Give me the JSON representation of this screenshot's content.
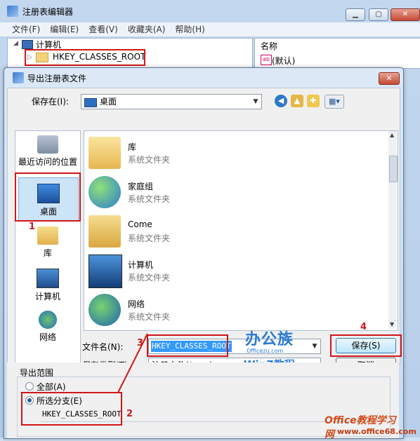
{
  "registry": {
    "title": "注册表编辑器",
    "menu": [
      "文件(F)",
      "编辑(E)",
      "查看(V)",
      "收藏夹(A)",
      "帮助(H)"
    ],
    "tree_root": "计算机",
    "tree_item": "HKEY_CLASSES_ROOT",
    "col_name": "名称",
    "default_value": "(默认)",
    "default_value_icon_text": "ab"
  },
  "dialog": {
    "title": "导出注册表文件",
    "close_label": "✕",
    "save_in_label": "保存在(I):",
    "save_in_value": "桌面",
    "places": [
      {
        "label": "最近访问的位置",
        "icon": "recent-places-icon"
      },
      {
        "label": "桌面",
        "icon": "desktop-icon"
      },
      {
        "label": "库",
        "icon": "libraries-icon"
      },
      {
        "label": "计算机",
        "icon": "computer-icon"
      },
      {
        "label": "网络",
        "icon": "network-icon"
      }
    ],
    "files": [
      {
        "name": "库",
        "type": "系统文件夹",
        "icon": "library-folder-icon"
      },
      {
        "name": "家庭组",
        "type": "系统文件夹",
        "icon": "homegroup-icon"
      },
      {
        "name": "Come",
        "type": "系统文件夹",
        "icon": "user-folder-icon"
      },
      {
        "name": "计算机",
        "type": "系统文件夹",
        "icon": "computer-icon"
      },
      {
        "name": "网络",
        "type": "系统文件夹",
        "icon": "network-icon"
      }
    ],
    "filename_label": "文件名(N):",
    "filename_value": "HKEY_CLASSES_ROOT",
    "filetype_label": "保存类型(T):",
    "filetype_value": "注册文件(*.reg)",
    "save_button": "保存(S)",
    "cancel_button": "取消",
    "export_range": {
      "title": "导出范围",
      "all_label": "全部(A)",
      "selected_label": "所选分支(E)",
      "selected_value": "HKEY_CLASSES_ROOT",
      "selected": "selected-branch"
    }
  },
  "annotations": {
    "n1": "1",
    "n2": "2",
    "n3": "3",
    "n4": "4"
  },
  "watermark": {
    "brand_cn": "办公族",
    "site": "Officezu.com",
    "win7": "Win7教程",
    "site2": "Office教程学习网",
    "url2": "www.office68.com"
  },
  "colors": {
    "annotation_red": "#d0161a",
    "accent_blue": "#2a7bd3"
  }
}
